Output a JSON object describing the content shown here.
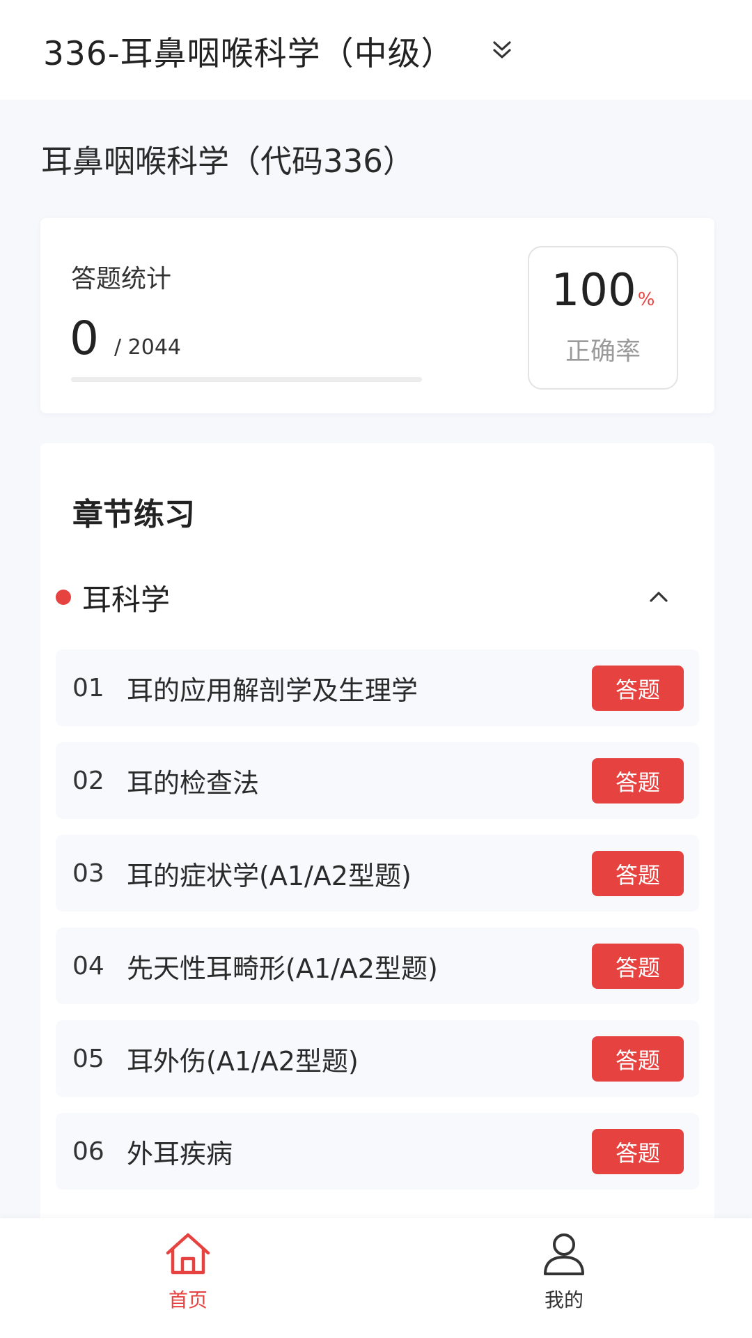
{
  "header": {
    "exam_title": "336-耳鼻咽喉科学（中级）"
  },
  "subject": {
    "title": "耳鼻咽喉科学（代码336）"
  },
  "stats": {
    "label": "答题统计",
    "answered": "0",
    "total": "/ 2044",
    "progress_fraction": 0,
    "accuracy_value": "100",
    "accuracy_unit": "%",
    "accuracy_label": "正确率"
  },
  "chapter": {
    "heading": "章节练习",
    "section_name": "耳科学",
    "answer_label": "答题",
    "items": [
      {
        "num": "01",
        "name": "耳的应用解剖学及生理学"
      },
      {
        "num": "02",
        "name": "耳的检查法"
      },
      {
        "num": "03",
        "name": "耳的症状学(A1/A2型题)"
      },
      {
        "num": "04",
        "name": "先天性耳畸形(A1/A2型题)"
      },
      {
        "num": "05",
        "name": "耳外伤(A1/A2型题)"
      },
      {
        "num": "06",
        "name": "外耳疾病"
      }
    ]
  },
  "nav": {
    "home_label": "首页",
    "mine_label": "我的"
  },
  "colors": {
    "accent": "#e64340",
    "background": "#f6f8fc"
  },
  "icons": {
    "dropdown": "double-chevron-down-icon",
    "collapse": "chevron-up-icon",
    "home": "home-icon",
    "mine": "user-icon"
  }
}
